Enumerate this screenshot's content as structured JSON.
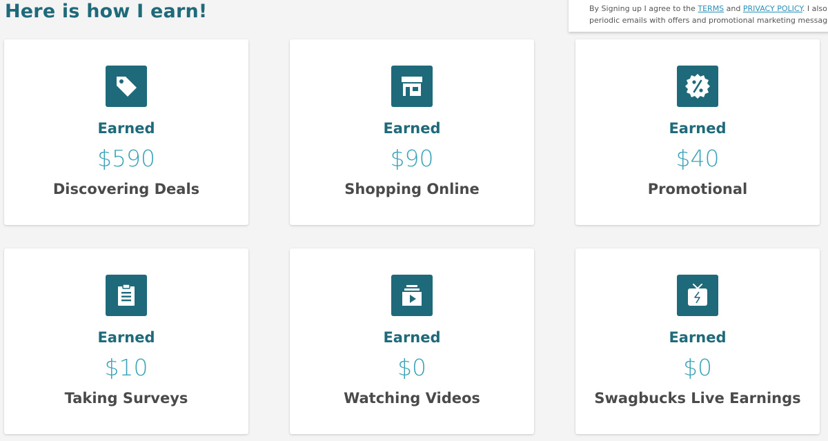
{
  "heading": "Here is how I earn!",
  "terms": {
    "line1_prefix": "By Signing up I agree to the ",
    "terms_link": "TERMS",
    "and_text": " and ",
    "privacy_link": "PRIVACY POLICY",
    "line1_suffix": ". I also ag",
    "line2": "periodic emails with offers and promotional marketing messages fr"
  },
  "colors": {
    "brand": "#1f6a7a",
    "amount": "#3aa3ba",
    "text_dark": "#4a4a4a",
    "link": "#2a8fb8"
  },
  "cards": [
    {
      "icon": "price-tag-icon",
      "earned_label": "Earned",
      "amount": "$590",
      "category": "Discovering Deals"
    },
    {
      "icon": "storefront-icon",
      "earned_label": "Earned",
      "amount": "$90",
      "category": "Shopping Online"
    },
    {
      "icon": "discount-badge-icon",
      "earned_label": "Earned",
      "amount": "$40",
      "category": "Promotional"
    },
    {
      "icon": "clipboard-icon",
      "earned_label": "Earned",
      "amount": "$10",
      "category": "Taking Surveys"
    },
    {
      "icon": "video-playlist-icon",
      "earned_label": "Earned",
      "amount": "$0",
      "category": "Watching Videos"
    },
    {
      "icon": "live-tv-icon",
      "earned_label": "Earned",
      "amount": "$0",
      "category": "Swagbucks Live Earnings"
    }
  ]
}
